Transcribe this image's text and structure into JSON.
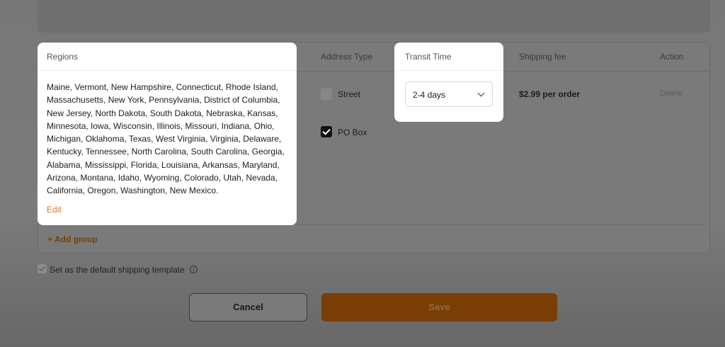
{
  "table": {
    "columns": {
      "regions": "Regions",
      "address_type": "Address Type",
      "transit_time": "Transit Time",
      "shipping_fee": "Shipping fee",
      "action": "Action"
    },
    "row": {
      "address_types": [
        {
          "label": "Street",
          "checked": false,
          "disabled": true
        },
        {
          "label": "PO Box",
          "checked": true
        }
      ],
      "shipping_fee": "$2.99 per order",
      "delete_label": "Delete"
    },
    "add_group_label": "Add group"
  },
  "regions_popup": {
    "title": "Regions",
    "text": "Maine, Vermont, New Hampshire, Connecticut, Rhode Island, Massachusetts, New York, Pennsylvania, District of Columbia, New Jersey, North Dakota, South Dakota, Nebraska, Kansas, Minnesota, Iowa, Wisconsin, Illinois, Missouri, Indiana, Ohio, Michigan, Oklahoma, Texas, West Virginia, Virginia, Delaware, Kentucky, Tennessee, North Carolina, South Carolina, Georgia, Alabama, Mississippi, Florida, Louisiana, Arkansas, Maryland, Arizona, Montana, Idaho, Wyoming, Colorado, Utah, Nevada, California, Oregon, Washington, New Mexico.",
    "edit_label": "Edit"
  },
  "transit_popup": {
    "title": "Transit Time",
    "selected": "2-4 days"
  },
  "default_template": {
    "label": "Set as the default shipping template",
    "checked": true
  },
  "footer": {
    "cancel_label": "Cancel",
    "save_label": "Save"
  },
  "colors": {
    "accent": "#e07b1a",
    "overlay": "#7a7a7a"
  }
}
